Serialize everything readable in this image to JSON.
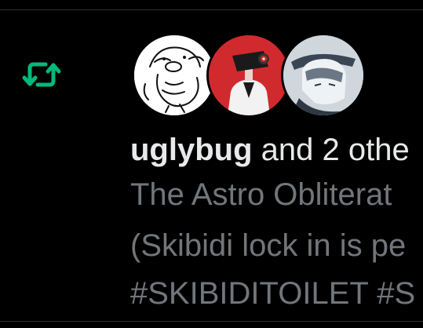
{
  "notification": {
    "type_icon": "retweet-icon",
    "accent_color": "#00ba7c",
    "avatars": [
      {
        "icon": "cartoon-bird-sketch-avatar"
      },
      {
        "icon": "camera-head-figure-avatar"
      },
      {
        "icon": "anime-character-avatar"
      }
    ],
    "username": "uglybug",
    "context_rest": "and 2 othe",
    "post_lines": [
      "The Astro Obliterat",
      "(Skibidi lock in is pe",
      "#SKIBIDITOILET #S"
    ]
  }
}
